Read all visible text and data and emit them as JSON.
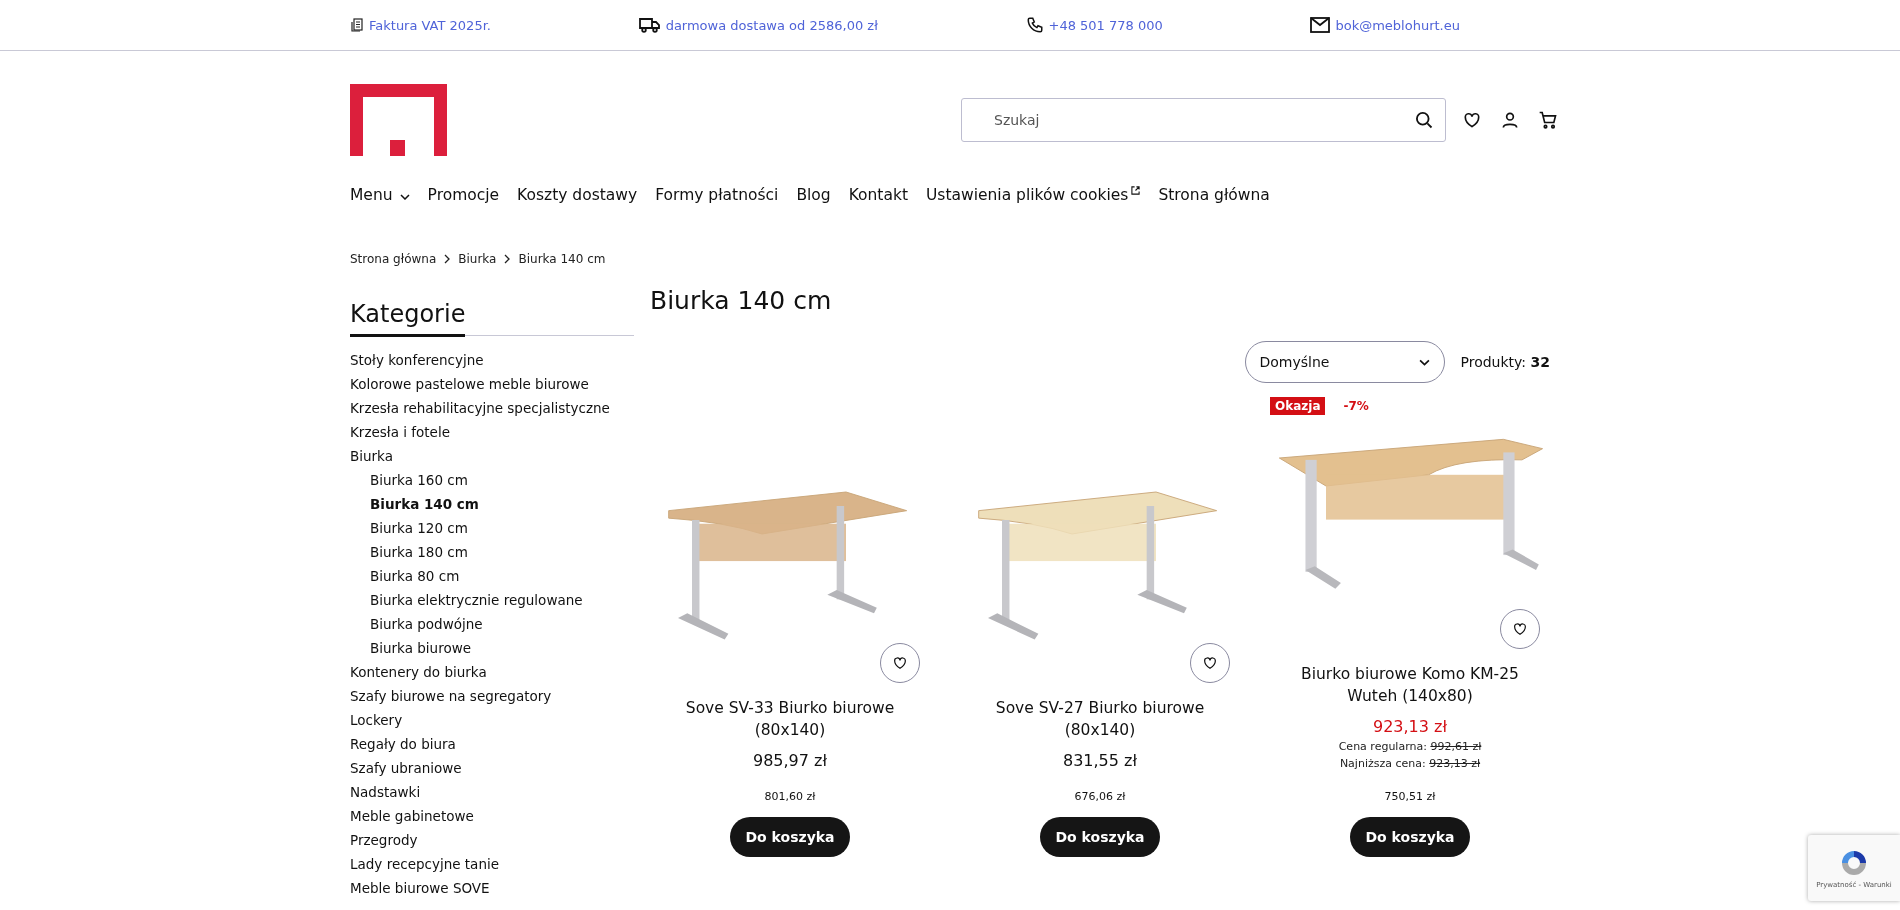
{
  "top_bar": [
    {
      "kind": "invoice",
      "text": "Faktura VAT 2025r."
    },
    {
      "kind": "delivery",
      "text": "darmowa dostawa od 2586,00 zł"
    },
    {
      "kind": "phone",
      "text": "+48 501 778 000"
    },
    {
      "kind": "mail",
      "text": "bok@meblohurt.eu"
    }
  ],
  "search": {
    "placeholder": "Szukaj"
  },
  "nav": [
    {
      "label": "Menu",
      "kind": "dropdown"
    },
    {
      "label": "Promocje",
      "kind": "link"
    },
    {
      "label": "Koszty dostawy",
      "kind": "link"
    },
    {
      "label": "Formy płatności",
      "kind": "link"
    },
    {
      "label": "Blog",
      "kind": "link"
    },
    {
      "label": "Kontakt",
      "kind": "link"
    },
    {
      "label": "Ustawienia plików cookies",
      "kind": "external"
    },
    {
      "label": "Strona główna",
      "kind": "link"
    }
  ],
  "breadcrumb": [
    "Strona główna",
    "Biurka",
    "Biurka 140 cm"
  ],
  "sidebar": {
    "title": "Kategorie",
    "items": [
      {
        "label": "Stoły konferencyjne",
        "selected": false
      },
      {
        "label": "Kolorowe pastelowe meble biurowe",
        "selected": false
      },
      {
        "label": "Krzesła rehabilitacyjne specjalistyczne",
        "selected": false
      },
      {
        "label": "Krzesła i fotele",
        "selected": false
      },
      {
        "label": "Biurka",
        "selected": false,
        "children": [
          {
            "label": "Biurka 160 cm",
            "selected": false
          },
          {
            "label": "Biurka 140 cm",
            "selected": true
          },
          {
            "label": "Biurka 120 cm",
            "selected": false
          },
          {
            "label": "Biurka 180 cm",
            "selected": false
          },
          {
            "label": "Biurka 80 cm",
            "selected": false
          },
          {
            "label": "Biurka elektrycznie regulowane",
            "selected": false
          },
          {
            "label": "Biurka podwójne",
            "selected": false
          },
          {
            "label": "Biurka biurowe",
            "selected": false
          }
        ]
      },
      {
        "label": "Kontenery do biurka",
        "selected": false
      },
      {
        "label": "Szafy biurowe na segregatory",
        "selected": false
      },
      {
        "label": "Lockery",
        "selected": false
      },
      {
        "label": "Regały do biura",
        "selected": false
      },
      {
        "label": "Szafy ubraniowe",
        "selected": false
      },
      {
        "label": "Nadstawki",
        "selected": false
      },
      {
        "label": "Meble gabinetowe",
        "selected": false
      },
      {
        "label": "Przegrody",
        "selected": false
      },
      {
        "label": "Lady recepcyjne tanie",
        "selected": false
      },
      {
        "label": "Meble biurowe SOVE",
        "selected": false
      }
    ]
  },
  "page_title": "Biurka 140 cm",
  "sort": {
    "value": "Domyślne"
  },
  "product_count": {
    "label": "Produkty:",
    "value": "32"
  },
  "products": [
    {
      "name": "Sove SV-33 Biurko biurowe (80x140)",
      "price": "985,97 zł",
      "net_price": "801,60 zł",
      "button": "Do koszyka"
    },
    {
      "name": "Sove SV-27 Biurko biurowe (80x140)",
      "price": "831,55 zł",
      "net_price": "676,06 zł",
      "button": "Do koszyka"
    },
    {
      "name": "Biurko biurowe Komo KM-25 Wuteh (140x80)",
      "badge": "Okazja",
      "discount": "-7%",
      "price": "923,13 zł",
      "regular_label": "Cena regularna:",
      "regular_price": "992,61 zł",
      "lowest_label": "Najniższa cena:",
      "lowest_price": "923,13 zł",
      "net_price": "750,51 zł",
      "button": "Do koszyka"
    }
  ],
  "recaptcha": {
    "text": "Prywatność - Warunki"
  }
}
